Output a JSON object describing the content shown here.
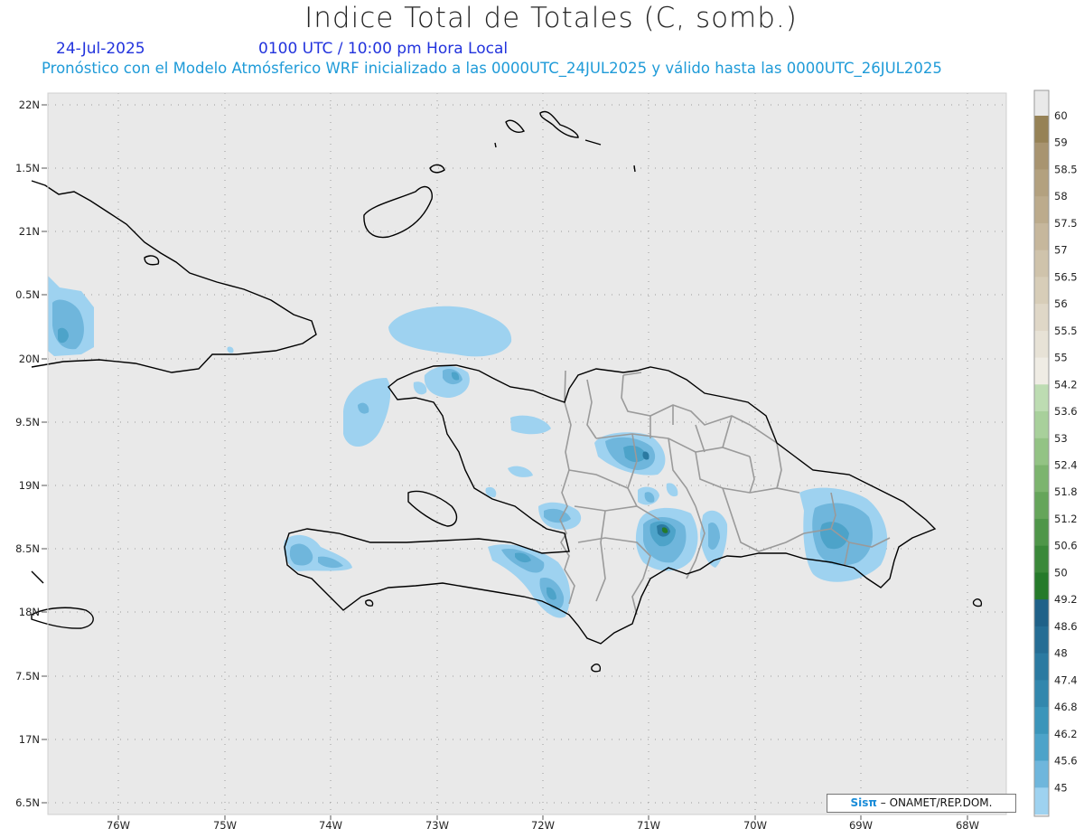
{
  "title": "Indice Total de Totales (C, somb.)",
  "date": "24-Jul-2025",
  "time": "0100 UTC / 10:00 pm Hora Local",
  "forecast_line": "Pronóstico con el Modelo Atmósferico WRF inicializado a las 0000UTC_24JUL2025 y válido hasta las  0000UTC_26JUL2025",
  "credit": {
    "logo": "Sisπ",
    "text": "– ONAMET/REP.DOM."
  },
  "map": {
    "extent": {
      "lon_min": -76.65,
      "lon_max": -67.6,
      "lat_min": 16.4,
      "lat_max": 22.1
    },
    "lat_ticks": [
      "22N",
      "1.5N",
      "21N",
      "0.5N",
      "20N",
      "9.5N",
      "19N",
      "8.5N",
      "18N",
      "7.5N",
      "17N",
      "6.5N"
    ],
    "lon_ticks": [
      "76W",
      "75W",
      "74W",
      "73W",
      "72W",
      "71W",
      "70W",
      "69W",
      "68W"
    ],
    "background": "#e9e9e9",
    "coast_color": "#000000",
    "border_color": "#999999"
  },
  "colorbar": {
    "labels": [
      "60",
      "59",
      "58.5",
      "58",
      "57.5",
      "57",
      "56.5",
      "56",
      "55.5",
      "55",
      "54.2",
      "53.6",
      "53",
      "52.4",
      "51.8",
      "51.2",
      "50.6",
      "50",
      "49.2",
      "48.6",
      "48",
      "47.4",
      "46.8",
      "46.2",
      "45.6",
      "45"
    ],
    "colors": [
      "#968256",
      "#a89470",
      "#b3a17f",
      "#bcab8c",
      "#c6b79c",
      "#cfc3ab",
      "#d7cdb8",
      "#dfd7c7",
      "#e7e2d6",
      "#efece4",
      "#bddcb2",
      "#a8d09b",
      "#93c384",
      "#7cb46e",
      "#65a55a",
      "#4f9649",
      "#3a8839",
      "#257a2a",
      "#1f6188",
      "#256d94",
      "#2b7aa1",
      "#3287ad",
      "#3b95ba",
      "#4da3c9",
      "#6fb6dc",
      "#9ed2f0"
    ]
  }
}
